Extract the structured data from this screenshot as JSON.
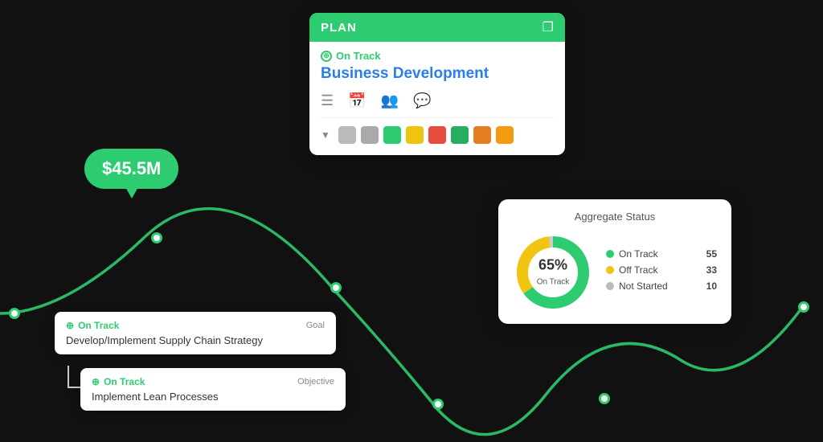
{
  "plan_card": {
    "header_title": "PLAN",
    "status_text": "On Track",
    "title": "Business Development",
    "colors": [
      "#bbb",
      "#aaa",
      "#2ecc71",
      "#f1c40f",
      "#e74c3c",
      "#27ae60",
      "#e67e22",
      "#f39c12"
    ]
  },
  "money_bubble": {
    "value": "$45.5M"
  },
  "agg_card": {
    "title": "Aggregate Status",
    "percentage": "65%",
    "label": "On Track",
    "legend": [
      {
        "label": "On Track",
        "color": "#2ecc71",
        "count": "55"
      },
      {
        "label": "Off Track",
        "color": "#f1c40f",
        "count": "33"
      },
      {
        "label": "Not Started",
        "color": "#bbb",
        "count": "10"
      }
    ]
  },
  "goal_card": {
    "status": "On Track",
    "type": "Goal",
    "text": "Develop/Implement Supply Chain Strategy"
  },
  "obj_card": {
    "status": "On Track",
    "type": "Objective",
    "text": "Implement Lean Processes"
  }
}
